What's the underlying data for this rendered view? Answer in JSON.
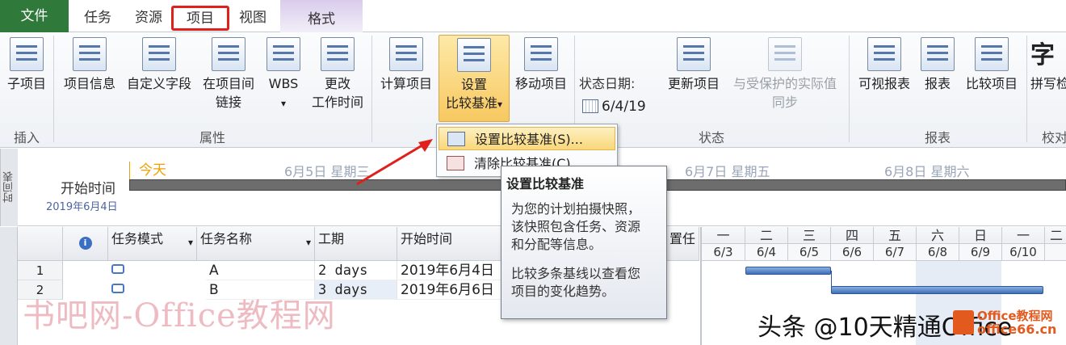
{
  "tabs": {
    "file": "文件",
    "task": "任务",
    "resource": "资源",
    "project": "项目",
    "view": "视图",
    "format": "格式"
  },
  "ribbon": {
    "groups": {
      "insert": "插入",
      "properties": "属性",
      "status": "状态",
      "reports": "报表",
      "proofing": "校对"
    },
    "buttons": {
      "subproject": "子项目",
      "project_info": "项目信息",
      "custom_fields": "自定义字段",
      "links1": "在项目间",
      "links2": "链接",
      "wbs": "WBS",
      "wbs_arrow": "▾",
      "change1": "更改",
      "change2": "工作时间",
      "calc": "计算项目",
      "baseline1": "设置",
      "baseline2": "比较基准",
      "baseline_arrow": "▾",
      "move": "移动项目",
      "update": "更新项目",
      "sync1": "与受保护的实际值",
      "sync2": "同步",
      "visual_reports": "可视报表",
      "reports": "报表",
      "compare": "比较项目",
      "spelling_cut": "拼写检",
      "spelling_icon": "字"
    },
    "status_date_label": "状态日期:",
    "status_date": "6/4/19"
  },
  "dropdown": {
    "set_baseline": "设置比较基准(S)...",
    "clear_baseline": "清除比较基准(C)..."
  },
  "tooltip": {
    "title": "设置比较基准",
    "lines1": [
      "为您的计划拍摄快照，",
      "该快照包含任务、资源",
      "和分配等信息。"
    ],
    "lines2": [
      "比较多条基线以查看您",
      "项目的变化趋势。"
    ]
  },
  "timeline": {
    "side_label": "时间表",
    "today": "今天",
    "start_label": "开始时间",
    "start_date": "2019年6月4日",
    "dates": [
      "6月5日  星期三",
      "6月7日  星期五",
      "6月8日  星期六"
    ]
  },
  "grid": {
    "info_icon": "i",
    "headers": [
      "任务模式",
      "任务名称",
      "工期",
      "开始时间",
      "置任"
    ],
    "header_arrow": "▾",
    "rows": [
      {
        "num": "1",
        "name": "A",
        "duration": "2 days",
        "start": "2019年6月4日"
      },
      {
        "num": "2",
        "name": "B",
        "duration": "3 days",
        "start": "2019年6月6日"
      }
    ]
  },
  "gantt": {
    "weekdays": [
      "一",
      "二",
      "三",
      "四",
      "五",
      "六",
      "日",
      "一",
      "二"
    ],
    "days": [
      "6/3",
      "6/4",
      "6/5",
      "6/6",
      "6/7",
      "6/8",
      "6/9",
      "6/10",
      ""
    ]
  },
  "watermarks": {
    "site": "书吧网-Office教程网",
    "toutiao": "头条 @10天精通Office",
    "logo1": "Office教程网",
    "logo2": "office66.cn"
  }
}
